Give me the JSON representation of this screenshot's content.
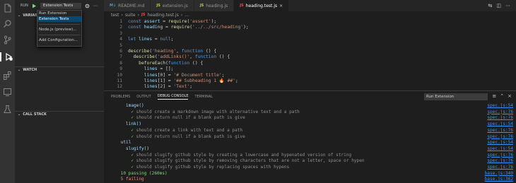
{
  "sidebar": {
    "run_label": "RUN",
    "config_value": "Extension Tests",
    "sections": [
      "VARIABLES",
      "WATCH",
      "CALL STACK"
    ]
  },
  "dropdown": {
    "items": [
      "Run Extension",
      "Extension Tests",
      "Node.js (preview)...",
      "Add Configuration..."
    ],
    "selected": "Extension Tests"
  },
  "tabs": [
    {
      "label": "README.md",
      "icon": "markdown-icon",
      "active": false
    },
    {
      "label": "extension.js",
      "icon": "js-icon",
      "active": false
    },
    {
      "label": "heading.js",
      "icon": "js-icon",
      "active": false
    },
    {
      "label": "heading.test.js",
      "icon": "js-icon",
      "active": true
    }
  ],
  "breadcrumb": [
    "test",
    "suite",
    "heading.test.js",
    "..."
  ],
  "editor": {
    "line_numbers": [
      "1",
      "2",
      "3",
      "4",
      "5",
      "6",
      "7",
      "8",
      "9",
      "10",
      "11",
      "12"
    ],
    "lines": [
      [
        [
          "kw",
          "const"
        ],
        [
          "punc",
          " "
        ],
        [
          "var",
          "assert"
        ],
        [
          "punc",
          " = "
        ],
        [
          "fn",
          "require"
        ],
        [
          "punc",
          "("
        ],
        [
          "str",
          "'assert'"
        ],
        [
          "punc",
          ");"
        ]
      ],
      [
        [
          "kw",
          "const"
        ],
        [
          "punc",
          " "
        ],
        [
          "var",
          "heading"
        ],
        [
          "punc",
          " = "
        ],
        [
          "fn",
          "require"
        ],
        [
          "punc",
          "("
        ],
        [
          "str",
          "'../../src/heading'"
        ],
        [
          "punc",
          ");"
        ]
      ],
      [],
      [
        [
          "kw",
          "let"
        ],
        [
          "punc",
          " "
        ],
        [
          "var",
          "lines"
        ],
        [
          "punc",
          " = "
        ],
        [
          "kw",
          "null"
        ],
        [
          "punc",
          ";"
        ]
      ],
      [],
      [
        [
          "fn",
          "describe"
        ],
        [
          "punc",
          "("
        ],
        [
          "str",
          "'heading'"
        ],
        [
          "punc",
          ", "
        ],
        [
          "kw",
          "function"
        ],
        [
          "punc",
          " () {"
        ]
      ],
      [
        [
          "punc",
          "  "
        ],
        [
          "fn",
          "describe"
        ],
        [
          "punc",
          "("
        ],
        [
          "str",
          "'addLinks()'"
        ],
        [
          "punc",
          ", "
        ],
        [
          "kw",
          "function"
        ],
        [
          "punc",
          " () {"
        ]
      ],
      [
        [
          "punc",
          "    "
        ],
        [
          "fn",
          "beforeEach"
        ],
        [
          "punc",
          "("
        ],
        [
          "kw",
          "function"
        ],
        [
          "punc",
          " () {"
        ]
      ],
      [
        [
          "punc",
          "      "
        ],
        [
          "var",
          "lines"
        ],
        [
          "punc",
          " = [];"
        ]
      ],
      [
        [
          "punc",
          "      "
        ],
        [
          "var",
          "lines"
        ],
        [
          "punc",
          "["
        ],
        [
          "num",
          "0"
        ],
        [
          "punc",
          "] = "
        ],
        [
          "str",
          "'# Document title'"
        ],
        [
          "punc",
          ";"
        ]
      ],
      [
        [
          "punc",
          "      "
        ],
        [
          "var",
          "lines"
        ],
        [
          "punc",
          "["
        ],
        [
          "num",
          "1"
        ],
        [
          "punc",
          "] = "
        ],
        [
          "str",
          "'## Subheading 1 🔥 ##'"
        ],
        [
          "punc",
          ";"
        ]
      ],
      [
        [
          "punc",
          "      "
        ],
        [
          "var",
          "lines"
        ],
        [
          "punc",
          "["
        ],
        [
          "num",
          "2"
        ],
        [
          "punc",
          "] = "
        ],
        [
          "str",
          "'Text'"
        ],
        [
          "punc",
          ";"
        ]
      ]
    ]
  },
  "panel": {
    "tabs": [
      "PROBLEMS",
      "OUTPUT",
      "DEBUG CONSOLE",
      "TERMINAL"
    ],
    "active_tab": "DEBUG CONSOLE",
    "selector_value": "Run Extension",
    "output": [
      {
        "text": "image()",
        "indent": 3,
        "cls": "suite",
        "src": "spec.js:54"
      },
      {
        "text": "✓ should create a markdown image with alternative text and a path",
        "indent": 5,
        "cls": "pass",
        "src": "spec.js:76"
      },
      {
        "text": "✓ should return null if a blank path is give",
        "indent": 5,
        "cls": "pass",
        "src": "spec.js:76"
      },
      {
        "text": "link()",
        "indent": 3,
        "cls": "suite",
        "src": "spec.js:54"
      },
      {
        "text": "✓ should create a link with text and a path",
        "indent": 5,
        "cls": "pass",
        "src": "spec.js:76"
      },
      {
        "text": "✓ should return null if a blank path is give",
        "indent": 5,
        "cls": "pass",
        "src": "spec.js:76"
      },
      {
        "text": "util",
        "indent": 1,
        "cls": "suite",
        "src": "spec.js:54"
      },
      {
        "text": "slugify()",
        "indent": 3,
        "cls": "suite",
        "src": "spec.js:54"
      },
      {
        "text": "✓ should slugify github style by creating a lowercase and hypenated version of string",
        "indent": 5,
        "cls": "pass",
        "src": "spec.js:76"
      },
      {
        "text": "✓ should slugify github style by removing characters that are not a letter, space or hypen",
        "indent": 5,
        "cls": "pass",
        "src": "spec.js:76"
      },
      {
        "text": "✓ should slugify github style by replacing spaces with hypens",
        "indent": 5,
        "cls": "pass",
        "src": "spec.js:76"
      },
      {
        "text": "10 passing (260ms)",
        "indent": 1,
        "cls": "pass",
        "src": "base.js:340"
      },
      {
        "text": "5 failing",
        "indent": 1,
        "cls": "fail",
        "src": "base.js:362"
      }
    ]
  }
}
